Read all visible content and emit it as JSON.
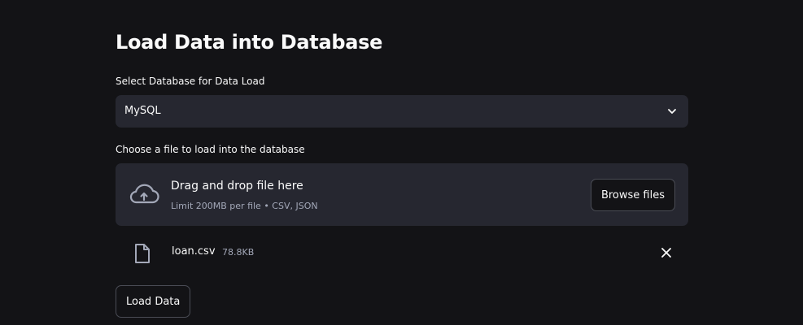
{
  "page": {
    "title": "Load Data into Database"
  },
  "database_select": {
    "label": "Select Database for Data Load",
    "selected_value": "MySQL",
    "icon": "chevron-down-icon"
  },
  "uploader": {
    "label": "Choose a file to load into the database",
    "dropzone_title": "Drag and drop file here",
    "dropzone_limit": "Limit 200MB per file • CSV, JSON",
    "browse_label": "Browse files",
    "icon": "cloud-upload-icon"
  },
  "uploaded_file": {
    "name": "loan.csv",
    "size": "78.8KB",
    "file_icon": "file-icon",
    "remove_icon": "close-icon"
  },
  "actions": {
    "load_label": "Load Data"
  },
  "colors": {
    "background": "#131316",
    "widget_background": "#262730",
    "text": "#fafafa",
    "muted_text": "#a3a8b8",
    "button_border": "#4a4c55"
  }
}
